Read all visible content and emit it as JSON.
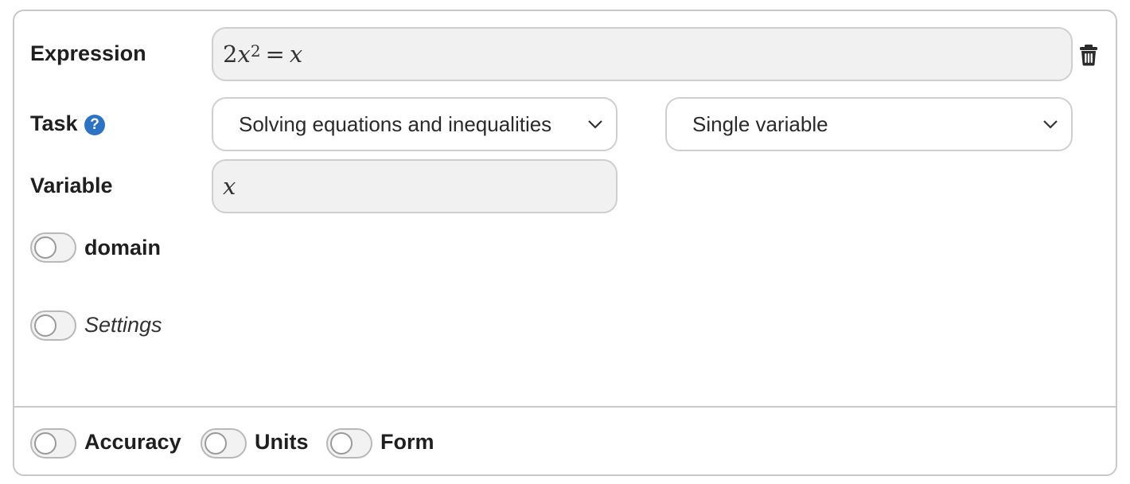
{
  "expression": {
    "label": "Expression",
    "value_parts": {
      "coef": "2",
      "var": "x",
      "exp": "2",
      "eq": "=",
      "rhs": "x"
    },
    "delete_icon": "trash-icon"
  },
  "task": {
    "label": "Task",
    "help_glyph": "?",
    "help_icon": "question-circle-icon",
    "type_select": {
      "value": "Solving equations and inequalities"
    },
    "mode_select": {
      "value": "Single variable"
    }
  },
  "variable": {
    "label": "Variable",
    "value": "x"
  },
  "toggles": {
    "domain": {
      "label": "domain",
      "on": false
    },
    "settings": {
      "label": "Settings",
      "on": false
    }
  },
  "footer": {
    "accuracy": {
      "label": "Accuracy",
      "on": false
    },
    "units": {
      "label": "Units",
      "on": false
    },
    "form": {
      "label": "Form",
      "on": false
    }
  },
  "colors": {
    "border": "#c8c8c8",
    "field_bg": "#f1f1f1",
    "help_blue": "#2d73c4",
    "text": "#1f1f1f"
  }
}
